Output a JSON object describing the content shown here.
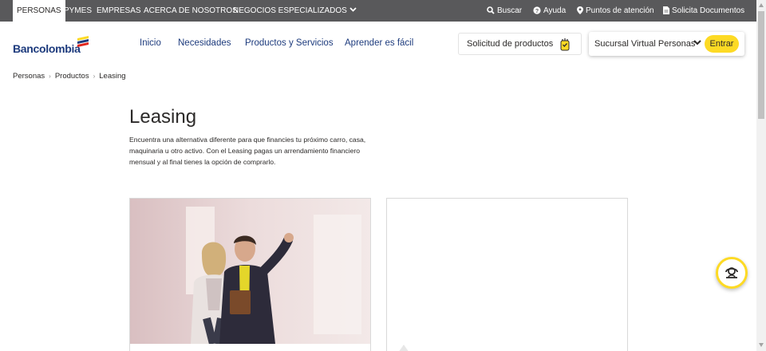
{
  "topbar": {
    "segments": [
      "PERSONAS",
      "PYMES",
      "EMPRESAS",
      "ACERCA DE NOSOTROS",
      "NEGOCIOS ESPECIALIZADOS"
    ],
    "utilities": {
      "search": "Buscar",
      "help": "Ayuda",
      "points": "Puntos de atención",
      "documents": "Solicita Documentos"
    }
  },
  "header": {
    "logo_text": "Bancolombia",
    "nav": [
      "Inicio",
      "Necesidades",
      "Productos y Servicios",
      "Aprender es fácil"
    ],
    "solicitud_label": "Solicitud de productos",
    "sucursal_label": "Sucursal Virtual Personas",
    "entrar_label": "Entrar"
  },
  "breadcrumb": [
    "Personas",
    "Productos",
    "Leasing"
  ],
  "hero": {
    "title": "Leasing",
    "description": "Encuentra una alternativa diferente para que financies tu próximo carro, casa, maquinaria u otro activo. Con el Leasing pagas un arrendamiento financiero mensual y al final tienes la opción de comprarlo."
  },
  "colors": {
    "topbar_bg": "#59595b",
    "brand_blue": "#1d3b7d",
    "brand_yellow": "#fdda24",
    "brand_red": "#e1261c"
  }
}
